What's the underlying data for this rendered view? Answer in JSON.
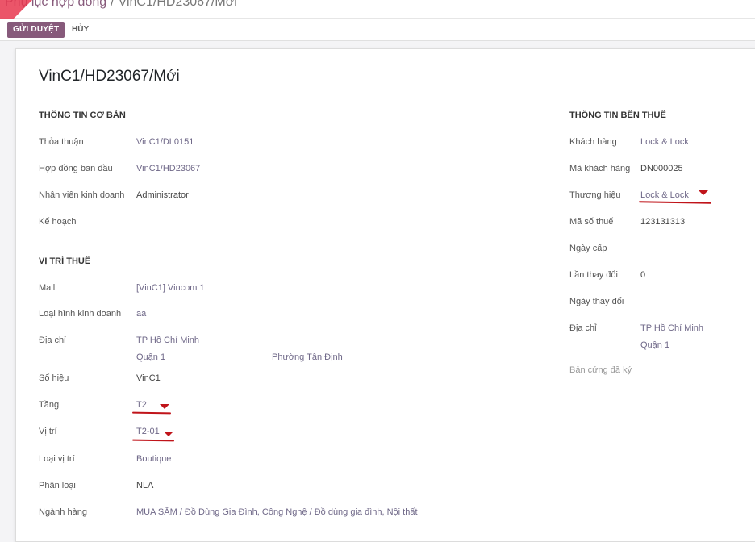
{
  "breadcrumb": {
    "parent": "Phụ lục hợp đồng",
    "separator": "/",
    "current": "VinC1/HD23067/Mới"
  },
  "toolbar": {
    "submit_label": "GỬI DUYỆT",
    "cancel_label": "HỦY"
  },
  "record": {
    "title": "VinC1/HD23067/Mới"
  },
  "basic_info": {
    "title": "THÔNG TIN CƠ BẢN",
    "agreement_label": "Thỏa thuận",
    "agreement_value": "VinC1/DL0151",
    "original_contract_label": "Hợp đồng ban đầu",
    "original_contract_value": "VinC1/HD23067",
    "salesperson_label": "Nhân viên kinh doanh",
    "salesperson_value": "Administrator",
    "plan_label": "Kế hoạch"
  },
  "location": {
    "title": "VỊ TRÍ THUÊ",
    "mall_label": "Mall",
    "mall_value": "[VinC1] Vincom 1",
    "business_type_label": "Loại hình kinh doanh",
    "business_type_value": "aa",
    "address_label": "Địa chỉ",
    "city": "TP Hồ Chí Minh",
    "district": "Quận 1",
    "ward": "Phường Tân Định",
    "code_label": "Số hiệu",
    "code_value": "VinC1",
    "floor_label": "Tầng",
    "floor_value": "T2",
    "position_label": "Vị trí",
    "position_value": "T2-01",
    "position_type_label": "Loại vị trí",
    "position_type_value": "Boutique",
    "class_label": "Phân loại",
    "class_value": "NLA",
    "industry_label": "Ngành hàng",
    "industry_value": "MUA SẮM / Đồ Dùng Gia Đình, Công Nghệ / Đồ dùng gia đình, Nội thất"
  },
  "tenant": {
    "title": "THÔNG TIN BÊN THUÊ",
    "customer_label": "Khách hàng",
    "customer_value": "Lock & Lock",
    "customer_code_label": "Mã khách hàng",
    "customer_code_value": "DN000025",
    "brand_label": "Thương hiệu",
    "brand_value": "Lock & Lock",
    "tax_code_label": "Mã số thuế",
    "tax_code_value": "123131313",
    "issue_date_label": "Ngày cấp",
    "change_count_label": "Lần thay đổi",
    "change_count_value": "0",
    "change_date_label": "Ngày thay đổi",
    "address_label": "Địa chỉ",
    "address_city": "TP Hồ Chí Minh",
    "address_district": "Quận 1",
    "signed_copy_label": "Bản cứng đã ký"
  },
  "colors": {
    "primary": "#875a7b",
    "annotation": "#c0141a"
  }
}
